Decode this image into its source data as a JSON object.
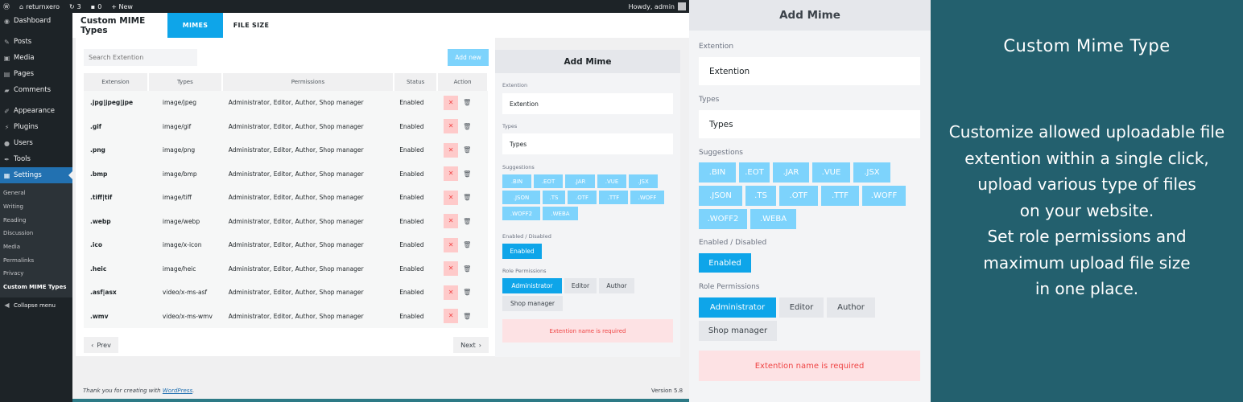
{
  "admin_bar": {
    "site_name": "returnxero",
    "updates": "3",
    "comments": "0",
    "new_label": "+ New",
    "howdy": "Howdy, admin"
  },
  "sidebar": {
    "items": [
      {
        "label": "Dashboard",
        "icon": "dashboard-icon"
      },
      {
        "label": "Posts",
        "icon": "pin-icon"
      },
      {
        "label": "Media",
        "icon": "media-icon"
      },
      {
        "label": "Pages",
        "icon": "pages-icon"
      },
      {
        "label": "Comments",
        "icon": "comment-icon"
      },
      {
        "label": "Appearance",
        "icon": "brush-icon"
      },
      {
        "label": "Plugins",
        "icon": "plug-icon"
      },
      {
        "label": "Users",
        "icon": "user-icon"
      },
      {
        "label": "Tools",
        "icon": "wrench-icon"
      },
      {
        "label": "Settings",
        "icon": "settings-icon"
      }
    ],
    "submenu": [
      "General",
      "Writing",
      "Reading",
      "Discussion",
      "Media",
      "Permalinks",
      "Privacy",
      "Custom MIME Types"
    ],
    "collapse": "Collapse menu"
  },
  "plugin": {
    "title": "Custom MIME Types",
    "tabs": [
      "MIMES",
      "FILE SIZE"
    ]
  },
  "search": {
    "placeholder": "Search Extention"
  },
  "add_new": "Add new",
  "table": {
    "headers": [
      "Extension",
      "Types",
      "Permissions",
      "Status",
      "Action"
    ],
    "rows": [
      {
        "ext": ".jpg|jpeg|jpe",
        "type": "image/jpeg",
        "perm": "Administrator, Editor, Author, Shop manager",
        "status": "Enabled"
      },
      {
        "ext": ".gif",
        "type": "image/gif",
        "perm": "Administrator, Editor, Author, Shop manager",
        "status": "Enabled"
      },
      {
        "ext": ".png",
        "type": "image/png",
        "perm": "Administrator, Editor, Author, Shop manager",
        "status": "Enabled"
      },
      {
        "ext": ".bmp",
        "type": "image/bmp",
        "perm": "Administrator, Editor, Author, Shop manager",
        "status": "Enabled"
      },
      {
        "ext": ".tiff|tif",
        "type": "image/tiff",
        "perm": "Administrator, Editor, Author, Shop manager",
        "status": "Enabled"
      },
      {
        "ext": ".webp",
        "type": "image/webp",
        "perm": "Administrator, Editor, Author, Shop manager",
        "status": "Enabled"
      },
      {
        "ext": ".ico",
        "type": "image/x-icon",
        "perm": "Administrator, Editor, Author, Shop manager",
        "status": "Enabled"
      },
      {
        "ext": ".heic",
        "type": "image/heic",
        "perm": "Administrator, Editor, Author, Shop manager",
        "status": "Enabled"
      },
      {
        "ext": ".asf|asx",
        "type": "video/x-ms-asf",
        "perm": "Administrator, Editor, Author, Shop manager",
        "status": "Enabled"
      },
      {
        "ext": ".wmv",
        "type": "video/x-ms-wmv",
        "perm": "Administrator, Editor, Author, Shop manager",
        "status": "Enabled"
      }
    ]
  },
  "pagination": {
    "prev": "Prev",
    "next": "Next"
  },
  "add_mime": {
    "title": "Add Mime",
    "ext_label": "Extention",
    "ext_placeholder": "Extention",
    "types_label": "Types",
    "types_placeholder": "Types",
    "suggestions_label": "Suggestions",
    "suggestions": [
      ".BIN",
      ".EOT",
      ".JAR",
      ".VUE",
      ".JSX",
      ".JSON",
      ".TS",
      ".OTF",
      ".TTF",
      ".WOFF",
      ".WOFF2",
      ".WEBA"
    ],
    "status_label": "Enabled / Disabled",
    "status_value": "Enabled",
    "roles_label": "Role Permissions",
    "roles": [
      "Administrator",
      "Editor",
      "Author",
      "Shop manager"
    ],
    "error": "Extention name is required"
  },
  "footer": {
    "thanks": "Thank you for creating with",
    "wp": "WordPress",
    "version": "Version 5.8"
  },
  "promo": {
    "title": "Custom Mime Type",
    "lines": [
      "Customize allowed uploadable file",
      "extention within a single click,",
      "upload various type of files",
      "on your website.",
      "Set role permissions and",
      "maximum upload file size",
      "in one place."
    ]
  },
  "colors": {
    "accent": "#0ea5e9",
    "chip": "#7dd3fc",
    "admin_dark": "#1d2327",
    "promo_bg": "#23606e",
    "error_bg": "#fde2e4"
  }
}
